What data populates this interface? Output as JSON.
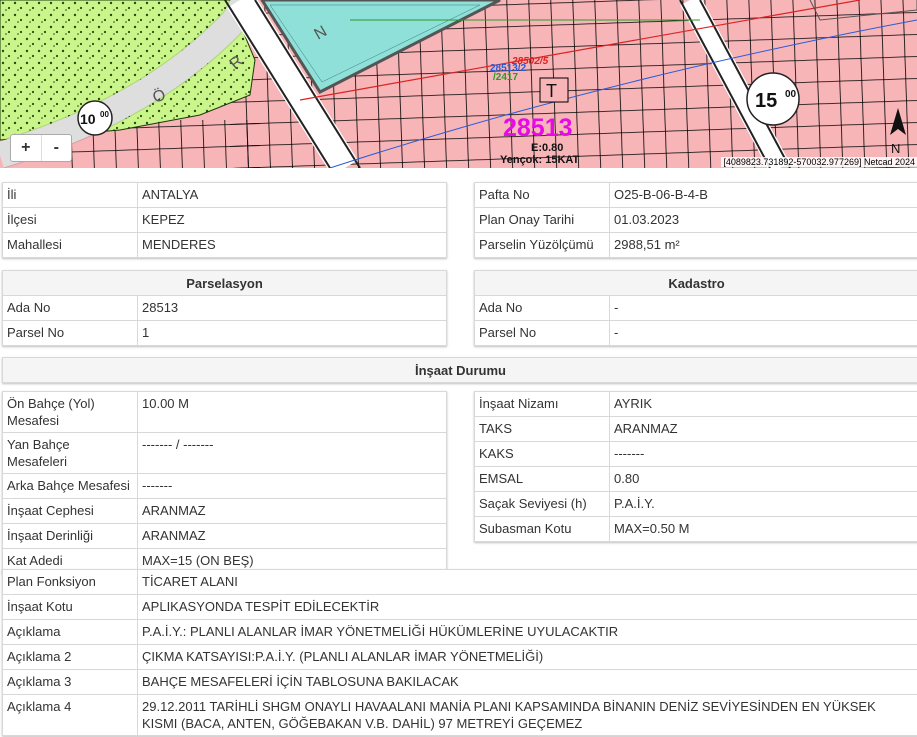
{
  "map": {
    "zoom_in": "+",
    "zoom_out": "-",
    "coords": "[4089823.731892-570032.977269] Netcad 2024",
    "parcel_big": "28513",
    "parcel_a": "28513/2",
    "parcel_b": "/2417",
    "parcel_c": "28502/5",
    "letter_t": "T",
    "emsal": "E:0.80",
    "yencok": "Yençok: 15KAT",
    "road_left": "10",
    "road_left_sup": "00",
    "road_right": "15",
    "road_right_sup": "00",
    "north": "N",
    "road_letters": [
      "Ö",
      "R",
      "N"
    ],
    "colors": {
      "parcel_pink": "#f7b5b8",
      "green_area": "#c9f58a",
      "teal_area": "#8fe0d8",
      "magenta_label": "#e60ae6"
    }
  },
  "location": [
    {
      "k": "İli",
      "v": "ANTALYA"
    },
    {
      "k": "İlçesi",
      "v": "KEPEZ"
    },
    {
      "k": "Mahallesi",
      "v": "MENDERES"
    }
  ],
  "plan": [
    {
      "k": "Pafta No",
      "v": "O25-B-06-B-4-B"
    },
    {
      "k": "Plan Onay Tarihi",
      "v": "01.03.2023"
    },
    {
      "k": "Parselin Yüzölçümü",
      "v": "2988,51 m²"
    }
  ],
  "parselasyon": {
    "title": "Parselasyon",
    "rows": [
      {
        "k": "Ada No",
        "v": "28513"
      },
      {
        "k": "Parsel No",
        "v": "1"
      }
    ]
  },
  "kadastro": {
    "title": "Kadastro",
    "rows": [
      {
        "k": "Ada No",
        "v": "-"
      },
      {
        "k": "Parsel No",
        "v": "-"
      }
    ]
  },
  "insaat_title": "İnşaat Durumu",
  "insaat_left": [
    {
      "k": "Ön Bahçe (Yol) Mesafesi",
      "v": "10.00 M"
    },
    {
      "k": "Yan Bahçe Mesafeleri",
      "v": "------- / -------"
    },
    {
      "k": "Arka Bahçe Mesafesi",
      "v": "-------"
    },
    {
      "k": "İnşaat Cephesi",
      "v": "ARANMAZ"
    },
    {
      "k": "İnşaat Derinliği",
      "v": "ARANMAZ"
    },
    {
      "k": "Kat Adedi",
      "v": "MAX=15 (ON BEŞ)"
    }
  ],
  "insaat_right": [
    {
      "k": "İnşaat Nizamı",
      "v": "AYRIK"
    },
    {
      "k": "TAKS",
      "v": "ARANMAZ"
    },
    {
      "k": "KAKS",
      "v": "-------"
    },
    {
      "k": "EMSAL",
      "v": "0.80"
    },
    {
      "k": "Saçak Seviyesi (h)",
      "v": "P.A.İ.Y."
    },
    {
      "k": "Subasman Kotu",
      "v": "MAX=0.50 M"
    }
  ],
  "bottom": [
    {
      "k": "Plan Fonksiyon",
      "v": "TİCARET ALANI"
    },
    {
      "k": "İnşaat Kotu",
      "v": "APLIKASYONDA TESPİT EDİLECEKTİR"
    },
    {
      "k": "Açıklama",
      "v": "P.A.İ.Y.: PLANLI ALANLAR İMAR YÖNETMELİĞİ HÜKÜMLERİNE UYULACAKTIR"
    },
    {
      "k": "Açıklama 2",
      "v": "ÇIKMA KATSAYISI:P.A.İ.Y. (PLANLI ALANLAR İMAR YÖNETMELİĞİ)"
    },
    {
      "k": "Açıklama 3",
      "v": "BAHÇE MESAFELERİ İÇİN TABLOSUNA BAKILACAK"
    },
    {
      "k": "Açıklama 4",
      "v": "29.12.2011 TARİHLİ SHGM ONAYLI HAVAALANI MANİA PLANI KAPSAMINDA BİNANIN DENİZ SEVİYESİNDEN EN YÜKSEK KISMI (BACA, ANTEN, GÖĞEBAKAN V.B. DAHİL) 97 METREYİ GEÇEMEZ"
    }
  ]
}
